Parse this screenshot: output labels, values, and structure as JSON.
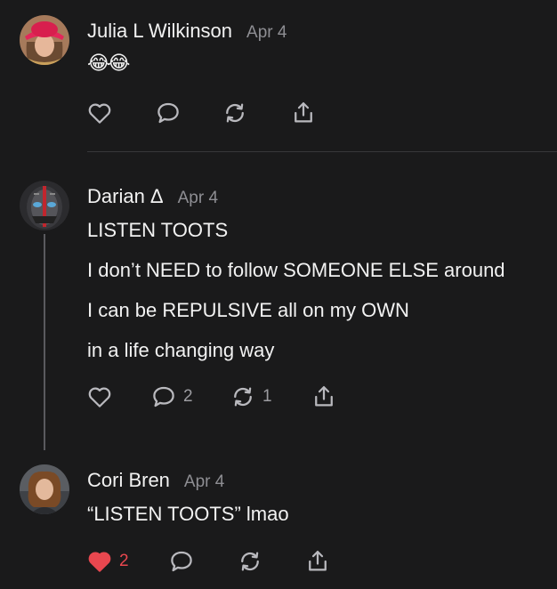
{
  "posts": [
    {
      "author": "Julia L Wilkinson",
      "time": "Apr 4",
      "emoji": "😂😂",
      "lines": [],
      "like_count": "",
      "reply_count": "",
      "repost_count": "",
      "liked": false
    },
    {
      "author": "Darian Δ",
      "time": "Apr 4",
      "lines": [
        "LISTEN TOOTS",
        "I don’t NEED to follow SOMEONE ELSE around",
        "I can be REPULSIVE all on my OWN",
        "in a life changing way"
      ],
      "like_count": "",
      "reply_count": "2",
      "repost_count": "1",
      "liked": false
    },
    {
      "author": "Cori Bren",
      "time": "Apr 4",
      "lines": [
        "“LISTEN TOOTS” lmao"
      ],
      "like_count": "2",
      "reply_count": "",
      "repost_count": "",
      "liked": true
    }
  ],
  "colors": {
    "background": "#1a1a1b",
    "text": "#f2f2f2",
    "muted": "#8e8e93",
    "like_active": "#e8474f",
    "icon": "#b9b9be"
  },
  "icons": [
    "heart-icon",
    "comment-icon",
    "repost-icon",
    "share-icon"
  ]
}
